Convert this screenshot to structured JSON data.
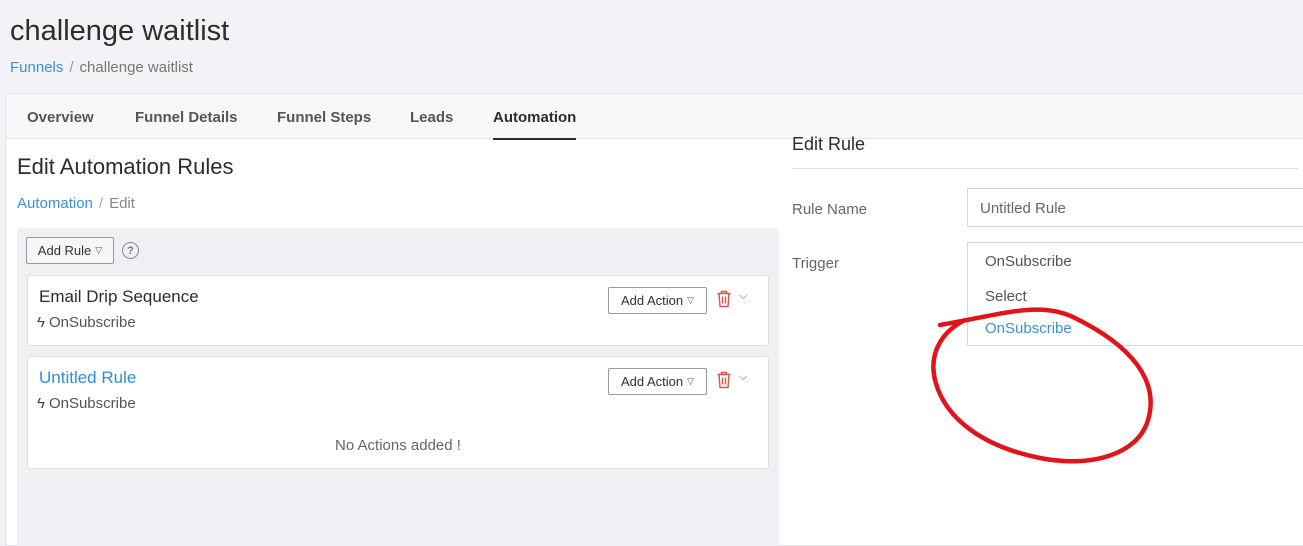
{
  "page": {
    "title": "challenge waitlist",
    "breadcrumb": {
      "link": "Funnels",
      "current": "challenge waitlist"
    }
  },
  "tabs": [
    "Overview",
    "Funnel Details",
    "Funnel Steps",
    "Leads",
    "Automation"
  ],
  "active_tab": "Automation",
  "editor": {
    "title": "Edit Automation Rules",
    "breadcrumb": {
      "link": "Automation",
      "current": "Edit"
    },
    "add_rule_label": "Add Rule",
    "help_glyph": "?",
    "rules": [
      {
        "name": "Email Drip Sequence",
        "trigger": "OnSubscribe",
        "add_action_label": "Add Action"
      },
      {
        "name": "Untitled Rule",
        "trigger": "OnSubscribe",
        "add_action_label": "Add Action",
        "empty_text": "No Actions added !"
      }
    ]
  },
  "edit_rule": {
    "title": "Edit Rule",
    "rule_name_label": "Rule Name",
    "rule_name_value": "Untitled Rule",
    "trigger_label": "Trigger",
    "trigger_value": "OnSubscribe",
    "trigger_options": [
      "Select",
      "OnSubscribe"
    ]
  },
  "colors": {
    "link": "#3d8fd6",
    "delete": "#d9534f",
    "annotation": "#e0141b"
  },
  "icons": {
    "help": "question-circle-icon",
    "trigger": "lightning-bolt-icon",
    "delete": "trash-icon",
    "expand": "chevron-down-icon",
    "dropdown": "caret-down-icon"
  }
}
